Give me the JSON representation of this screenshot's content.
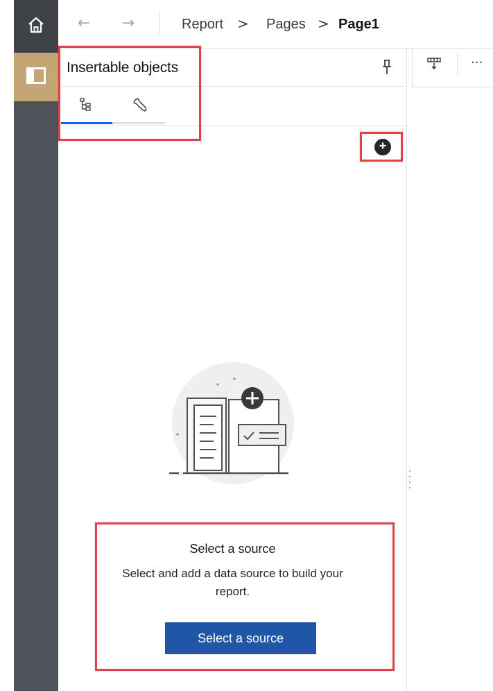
{
  "nav": {
    "home_icon": "home-icon",
    "panel_icon": "panel-toggle-icon",
    "back_icon": "arrow-left-icon",
    "forward_icon": "arrow-right-icon",
    "back_glyph": "←",
    "forward_glyph": "→"
  },
  "breadcrumb": {
    "items": [
      "Report",
      "Pages",
      "Page1"
    ],
    "separator": ">"
  },
  "panel": {
    "title": "Insertable objects",
    "pin_icon": "pin-icon",
    "tabs": [
      {
        "icon": "source-tree-icon",
        "selected": true
      },
      {
        "icon": "wrench-icon",
        "selected": false
      }
    ],
    "add_icon": "add-circle-icon"
  },
  "empty_state": {
    "title": "Select a source",
    "description": "Select and add a data source to build your report.",
    "button_label": "Select a source"
  },
  "toolbar_right": {
    "column_icon": "insert-column-icon",
    "more_label": "···"
  },
  "colors": {
    "rail": "#4f5258",
    "rail_active": "#c4a576",
    "primary_button": "#1f57a6",
    "highlight": "#e0424a",
    "tab_indicator": "#0f62fe"
  }
}
